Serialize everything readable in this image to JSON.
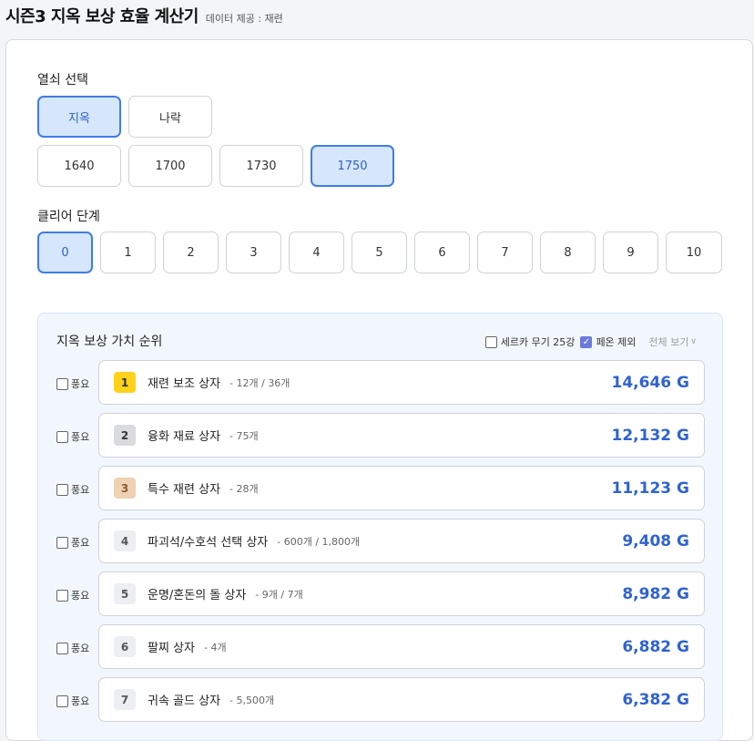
{
  "header": {
    "title": "시즌3 지옥 보상 효율 계산기",
    "credit": "데이터 제공 : 재련"
  },
  "key_section": {
    "label": "열쇠 선택",
    "modes": [
      {
        "label": "지옥",
        "active": true
      },
      {
        "label": "나락",
        "active": false
      }
    ],
    "levels": [
      {
        "label": "1640",
        "active": false
      },
      {
        "label": "1700",
        "active": false
      },
      {
        "label": "1730",
        "active": false
      },
      {
        "label": "1750",
        "active": true
      }
    ]
  },
  "clear_section": {
    "label": "클리어 단계",
    "steps": [
      "0",
      "1",
      "2",
      "3",
      "4",
      "5",
      "6",
      "6",
      "7",
      "8",
      "9",
      "10"
    ],
    "active_index": 0
  },
  "ranking": {
    "title": "지옥 보상 가치 순위",
    "filters": [
      {
        "label": "세르카 무기 25강",
        "checked": false
      },
      {
        "label": "페온 제외",
        "checked": true
      }
    ],
    "view_all": "전체 보기",
    "items": [
      {
        "check_label": "풍요",
        "rank": "1",
        "name": "재련 보조 상자",
        "qty": "- 12개 / 36개",
        "value": "14,646 G"
      },
      {
        "check_label": "풍요",
        "rank": "2",
        "name": "융화 재료 상자",
        "qty": "- 75개",
        "value": "12,132 G"
      },
      {
        "check_label": "풍요",
        "rank": "3",
        "name": "특수 재련 상자",
        "qty": "- 28개",
        "value": "11,123 G"
      },
      {
        "check_label": "풍요",
        "rank": "4",
        "name": "파괴석/수호석 선택 상자",
        "qty": "- 600개 / 1,800개",
        "value": "9,408 G"
      },
      {
        "check_label": "풍요",
        "rank": "5",
        "name": "운명/혼돈의 돌 상자",
        "qty": "- 9개 / 7개",
        "value": "8,982 G"
      },
      {
        "check_label": "풍요",
        "rank": "6",
        "name": "팔찌 상자",
        "qty": "- 4개",
        "value": "6,882 G"
      },
      {
        "check_label": "풍요",
        "rank": "7",
        "name": "귀속 골드 상자",
        "qty": "- 5,500개",
        "value": "6,382 G"
      }
    ]
  }
}
